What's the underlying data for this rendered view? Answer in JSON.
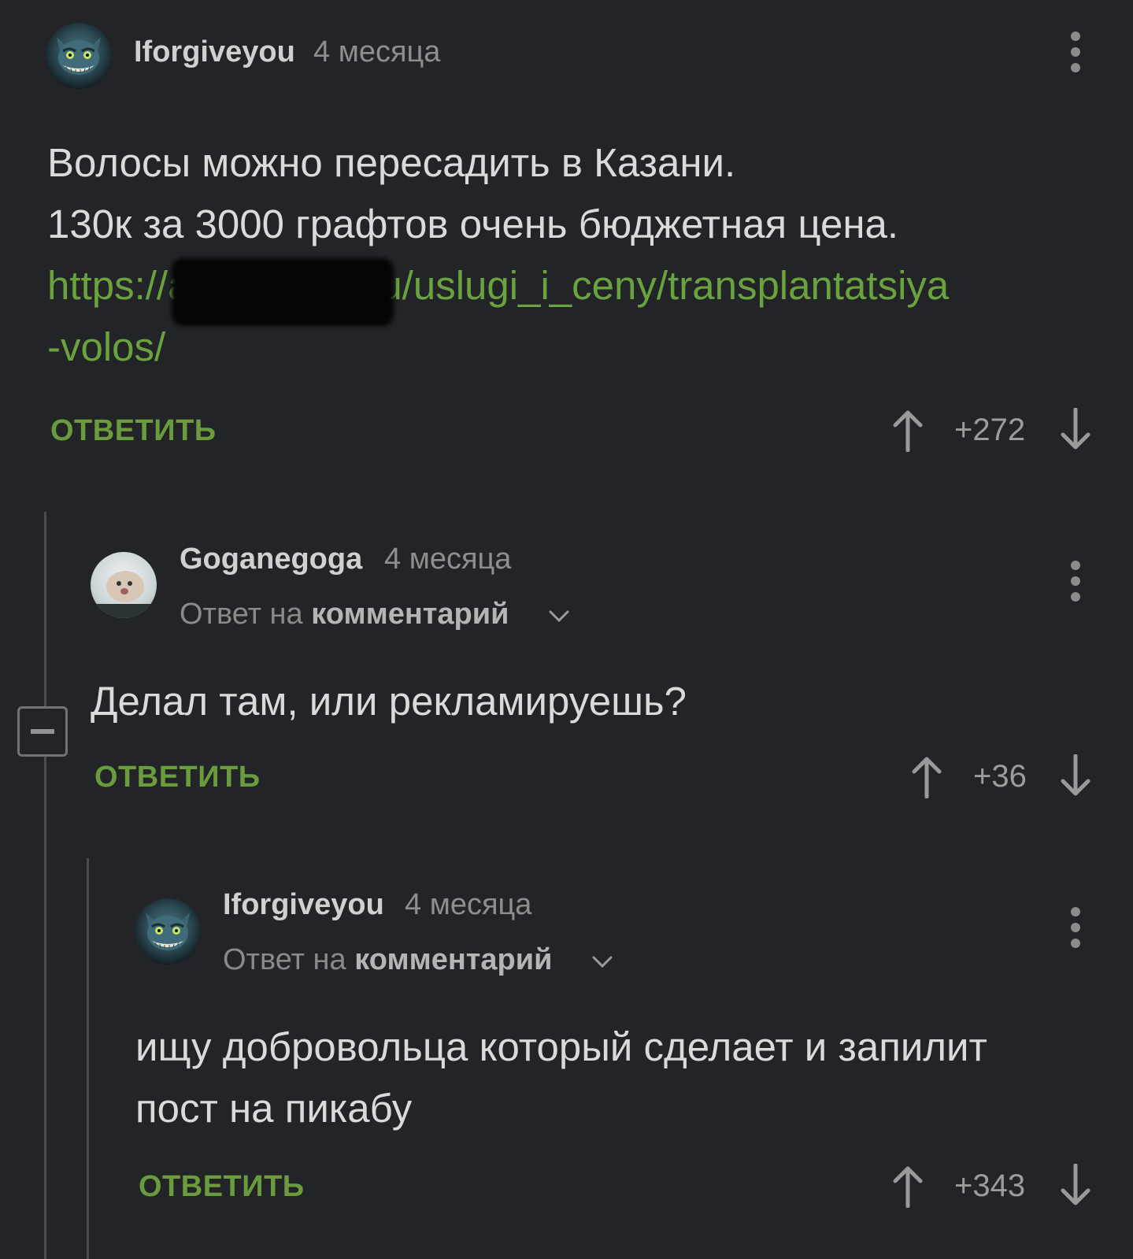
{
  "comments": [
    {
      "author": "Iforgiveyou",
      "time": "4 месяца",
      "lines": [
        "Волосы можно пересадить в Казани.",
        "130к за 3000 графтов очень бюджетная цена."
      ],
      "link_line1": "https://artmedkzn.ru/uslugi_i_ceny/transplantatsiya",
      "link_line2": "-volos/",
      "reply_label": "ОТВЕТИТЬ",
      "score": "+272"
    },
    {
      "author": "Goganegoga",
      "time": "4 месяца",
      "reply_prefix": "Ответ на",
      "reply_target": "комментарий",
      "text": "Делал там, или рекламируешь?",
      "reply_label": "ОТВЕТИТЬ",
      "score": "+36"
    },
    {
      "author": "Iforgiveyou",
      "time": "4 месяца",
      "reply_prefix": "Ответ на",
      "reply_target": "комментарий",
      "lines": [
        "ищу добровольца который сделает и запилит",
        "пост на пикабу"
      ],
      "reply_label": "ОТВЕТИТЬ",
      "score": "+343"
    }
  ],
  "icons": {
    "upvote": "arrow-up-icon",
    "downvote": "arrow-down-icon",
    "more": "more-vertical-icon",
    "chevron": "chevron-down-icon",
    "collapse": "minus-square-icon"
  },
  "colors": {
    "background": "#222428",
    "link": "#6aa33e",
    "reply": "#6a9c3d",
    "thread_line": "#4a4c50"
  }
}
